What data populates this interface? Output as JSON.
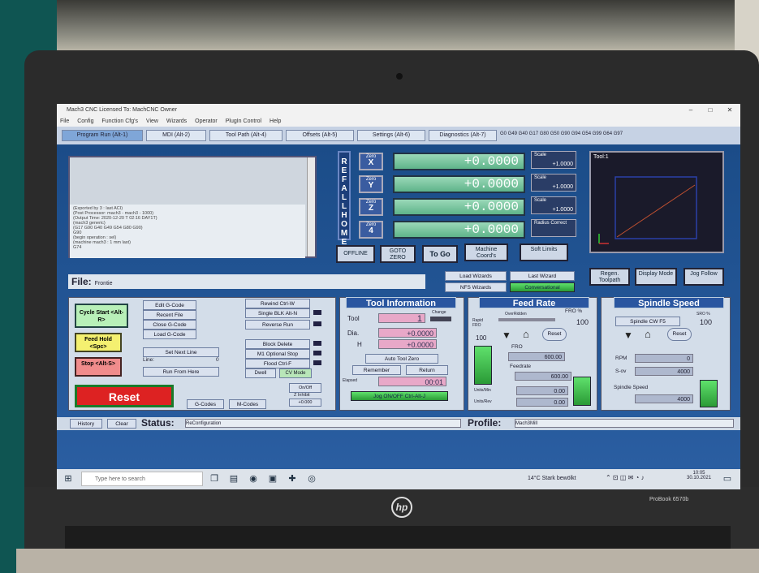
{
  "window": {
    "title": "Mach3 CNC Licensed To: MachCNC Owner",
    "minimize": "–",
    "maximize": "□",
    "close": "✕"
  },
  "menu": [
    "File",
    "Config",
    "Function Cfg's",
    "View",
    "Wizards",
    "Operator",
    "PlugIn Control",
    "Help"
  ],
  "tabs": [
    "Program Run (Alt-1)",
    "MDI (Alt-2)",
    "Tool Path (Alt-4)",
    "Offsets (Alt-5)",
    "Settings (Alt-6)",
    "Diagnostics (Alt-7)"
  ],
  "gcode_line": "G0 G49 G40 G17 G80 G50 G90 G94 G54 G99 G64 G97",
  "message": {
    "lines": [
      "(Exported by 3 : last ACI)",
      "(Post Processor: mach3 - mach3 - 1000)",
      "(Output Time: 2020-12-20 T 02:16 DAY1T)",
      "(mach3 generic)",
      "(G17 G90 G40 G49 G54 G80 G90)",
      "G90",
      "(begin operation : sel)",
      "(machine mach3 : 1 mm last)",
      "G74"
    ]
  },
  "ref_all_home": "REF ALL HOME",
  "axes": [
    {
      "zero_label": "Zero",
      "axis": "X",
      "value": "+0.0000",
      "scale_label": "Scale",
      "scale": "+1.0000"
    },
    {
      "zero_label": "Zero",
      "axis": "Y",
      "value": "+0.0000",
      "scale_label": "Scale",
      "scale": "+1.0000"
    },
    {
      "zero_label": "Zero",
      "axis": "Z",
      "value": "+0.0000",
      "scale_label": "Scale",
      "scale": "+1.0000"
    },
    {
      "zero_label": "Zero",
      "axis": "4",
      "value": "+0.0000",
      "scale_label": "Radius Correct",
      "scale": ""
    }
  ],
  "dro_buttons": {
    "offline": "OFFLINE",
    "goto_zero": "GOTO ZERO",
    "to_go": "To Go",
    "machine_coords": "Machine Coord's",
    "soft_limits": "Soft Limits"
  },
  "preview": {
    "tool_label": "Tool:1"
  },
  "view_buttons": {
    "regen": "Regen. Toolpath",
    "display_mode": "Display Mode",
    "jog_follow": "Jog Follow"
  },
  "wizards": {
    "load": "Load Wizards",
    "last": "Last Wizard",
    "nfs": "NFS Wizards",
    "conversational": "Conversational"
  },
  "file": {
    "label": "File:",
    "value": "Frontie"
  },
  "left_controls": {
    "cycle_start": "Cycle Start <Alt-R>",
    "feed_hold": "Feed Hold <Spc>",
    "stop": "Stop <Alt-S>",
    "reset": "Reset"
  },
  "program_buttons": {
    "edit": "Edit G-Code",
    "recent": "Recent File",
    "close": "Close G-Code",
    "load": "Load G-Code",
    "set_next": "Set Next Line",
    "line_label": "Line:",
    "line_value": "0",
    "run_from_here": "Run From Here",
    "rewind": "Rewind Ctrl-W",
    "single": "Single BLK Alt-N",
    "reverse": "Reverse Run",
    "block_delete": "Block Delete",
    "optional_stop": "M1 Optional Stop",
    "flood": "Flood Ctrl-F",
    "dwell": "Dwell",
    "cv_mode": "CV Mode",
    "on_off": "On/Off",
    "z_inhibit": "Z Inhibit",
    "z_value": "+0.000",
    "gcodes": "G-Codes",
    "mcodes": "M-Codes"
  },
  "tool_info": {
    "title": "Tool Information",
    "tool_label": "Tool",
    "tool": "1",
    "change_label": "Change",
    "dia_label": "Dia.",
    "dia": "+0.0000",
    "h_label": "H",
    "h": "+0.0000",
    "auto_zero": "Auto Tool Zero",
    "remember": "Remember",
    "return": "Return",
    "elapsed_label": "Elapsed",
    "elapsed": "00:01",
    "jog": "Jog ON/OFF Ctrl-Alt-J"
  },
  "feed_rate": {
    "title": "Feed Rate",
    "overridden": "OverRidden",
    "fro_pct_label": "FRO %",
    "fro_pct": "100",
    "rapid_label": "Rapid FRO",
    "rapid": "100",
    "reset": "Reset",
    "fro_label": "FRO",
    "fro": "600.00",
    "feedrate_label": "Feedrate",
    "feedrate": "600.00",
    "units_min_label": "Units/Min",
    "units_min": "0.00",
    "units_rev_label": "Units/Rev",
    "units_rev": "0.00"
  },
  "spindle": {
    "title": "Spindle Speed",
    "cw": "Spindle CW F5",
    "sro_label": "SRO %",
    "sro": "100",
    "reset": "Reset",
    "rpm_label": "RPM",
    "rpm": "0",
    "sov_label": "S-ov",
    "sov": "4000",
    "speed_label": "Spindle Speed",
    "speed": "4000"
  },
  "status": {
    "history": "History",
    "clear": "Clear",
    "label": "Status:",
    "value": "ReConfiguration",
    "profile_label": "Profile:",
    "profile": "Mach3Mill"
  },
  "taskbar": {
    "search": "Type here to search",
    "weather": "14°C Stark bewölkt",
    "time": "10:05",
    "date": "30.10.2021"
  },
  "laptop": {
    "brand": "hp",
    "model": "ProBook 6570b"
  },
  "colors": {
    "app_bg": "#1b4c88",
    "dro_green": "#6ec298",
    "title_blue": "#2a56a0",
    "reset_red": "#d22"
  }
}
